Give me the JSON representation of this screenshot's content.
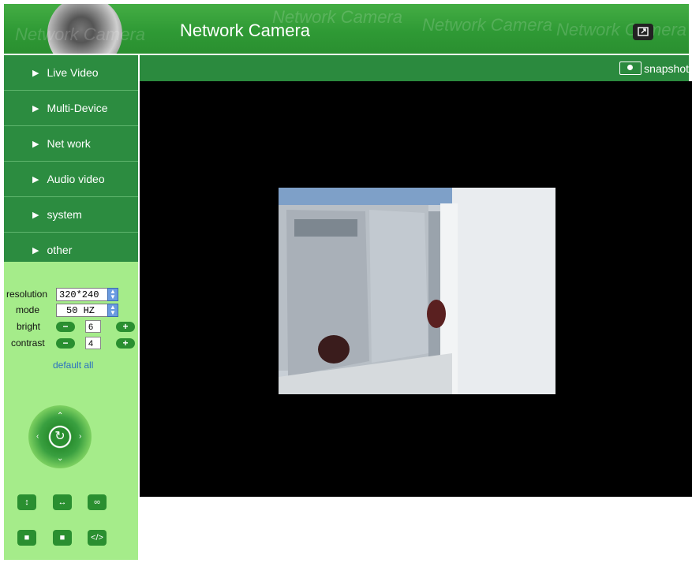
{
  "header": {
    "title": "Network Camera",
    "watermark": "Network Camera",
    "fullscreen_icon": "fullscreen-icon"
  },
  "sidebar": {
    "items": [
      {
        "label": "Live Video"
      },
      {
        "label": "Multi-Device"
      },
      {
        "label": "Net work"
      },
      {
        "label": "Audio video"
      },
      {
        "label": "system"
      },
      {
        "label": "other"
      }
    ]
  },
  "controls": {
    "resolution_label": "resolution",
    "resolution_value": "320*240",
    "mode_label": "mode",
    "mode_value": "50 HZ",
    "bright_label": "bright",
    "bright_value": "6",
    "contrast_label": "contrast",
    "contrast_value": "4",
    "default_all": "default all",
    "minus": "−",
    "plus": "+",
    "ptz_buttons": [
      "vertical-patrol",
      "horizontal-patrol",
      "infinite-patrol",
      "stop-1",
      "stop-2",
      "code"
    ]
  },
  "toolbar": {
    "snapshot_label": "snapshot"
  },
  "colors": {
    "header_green": "#2f9a35",
    "sidebar_green": "#2b8a3e",
    "panel_light_green": "#a5ec8a",
    "video_bg": "#000000"
  }
}
